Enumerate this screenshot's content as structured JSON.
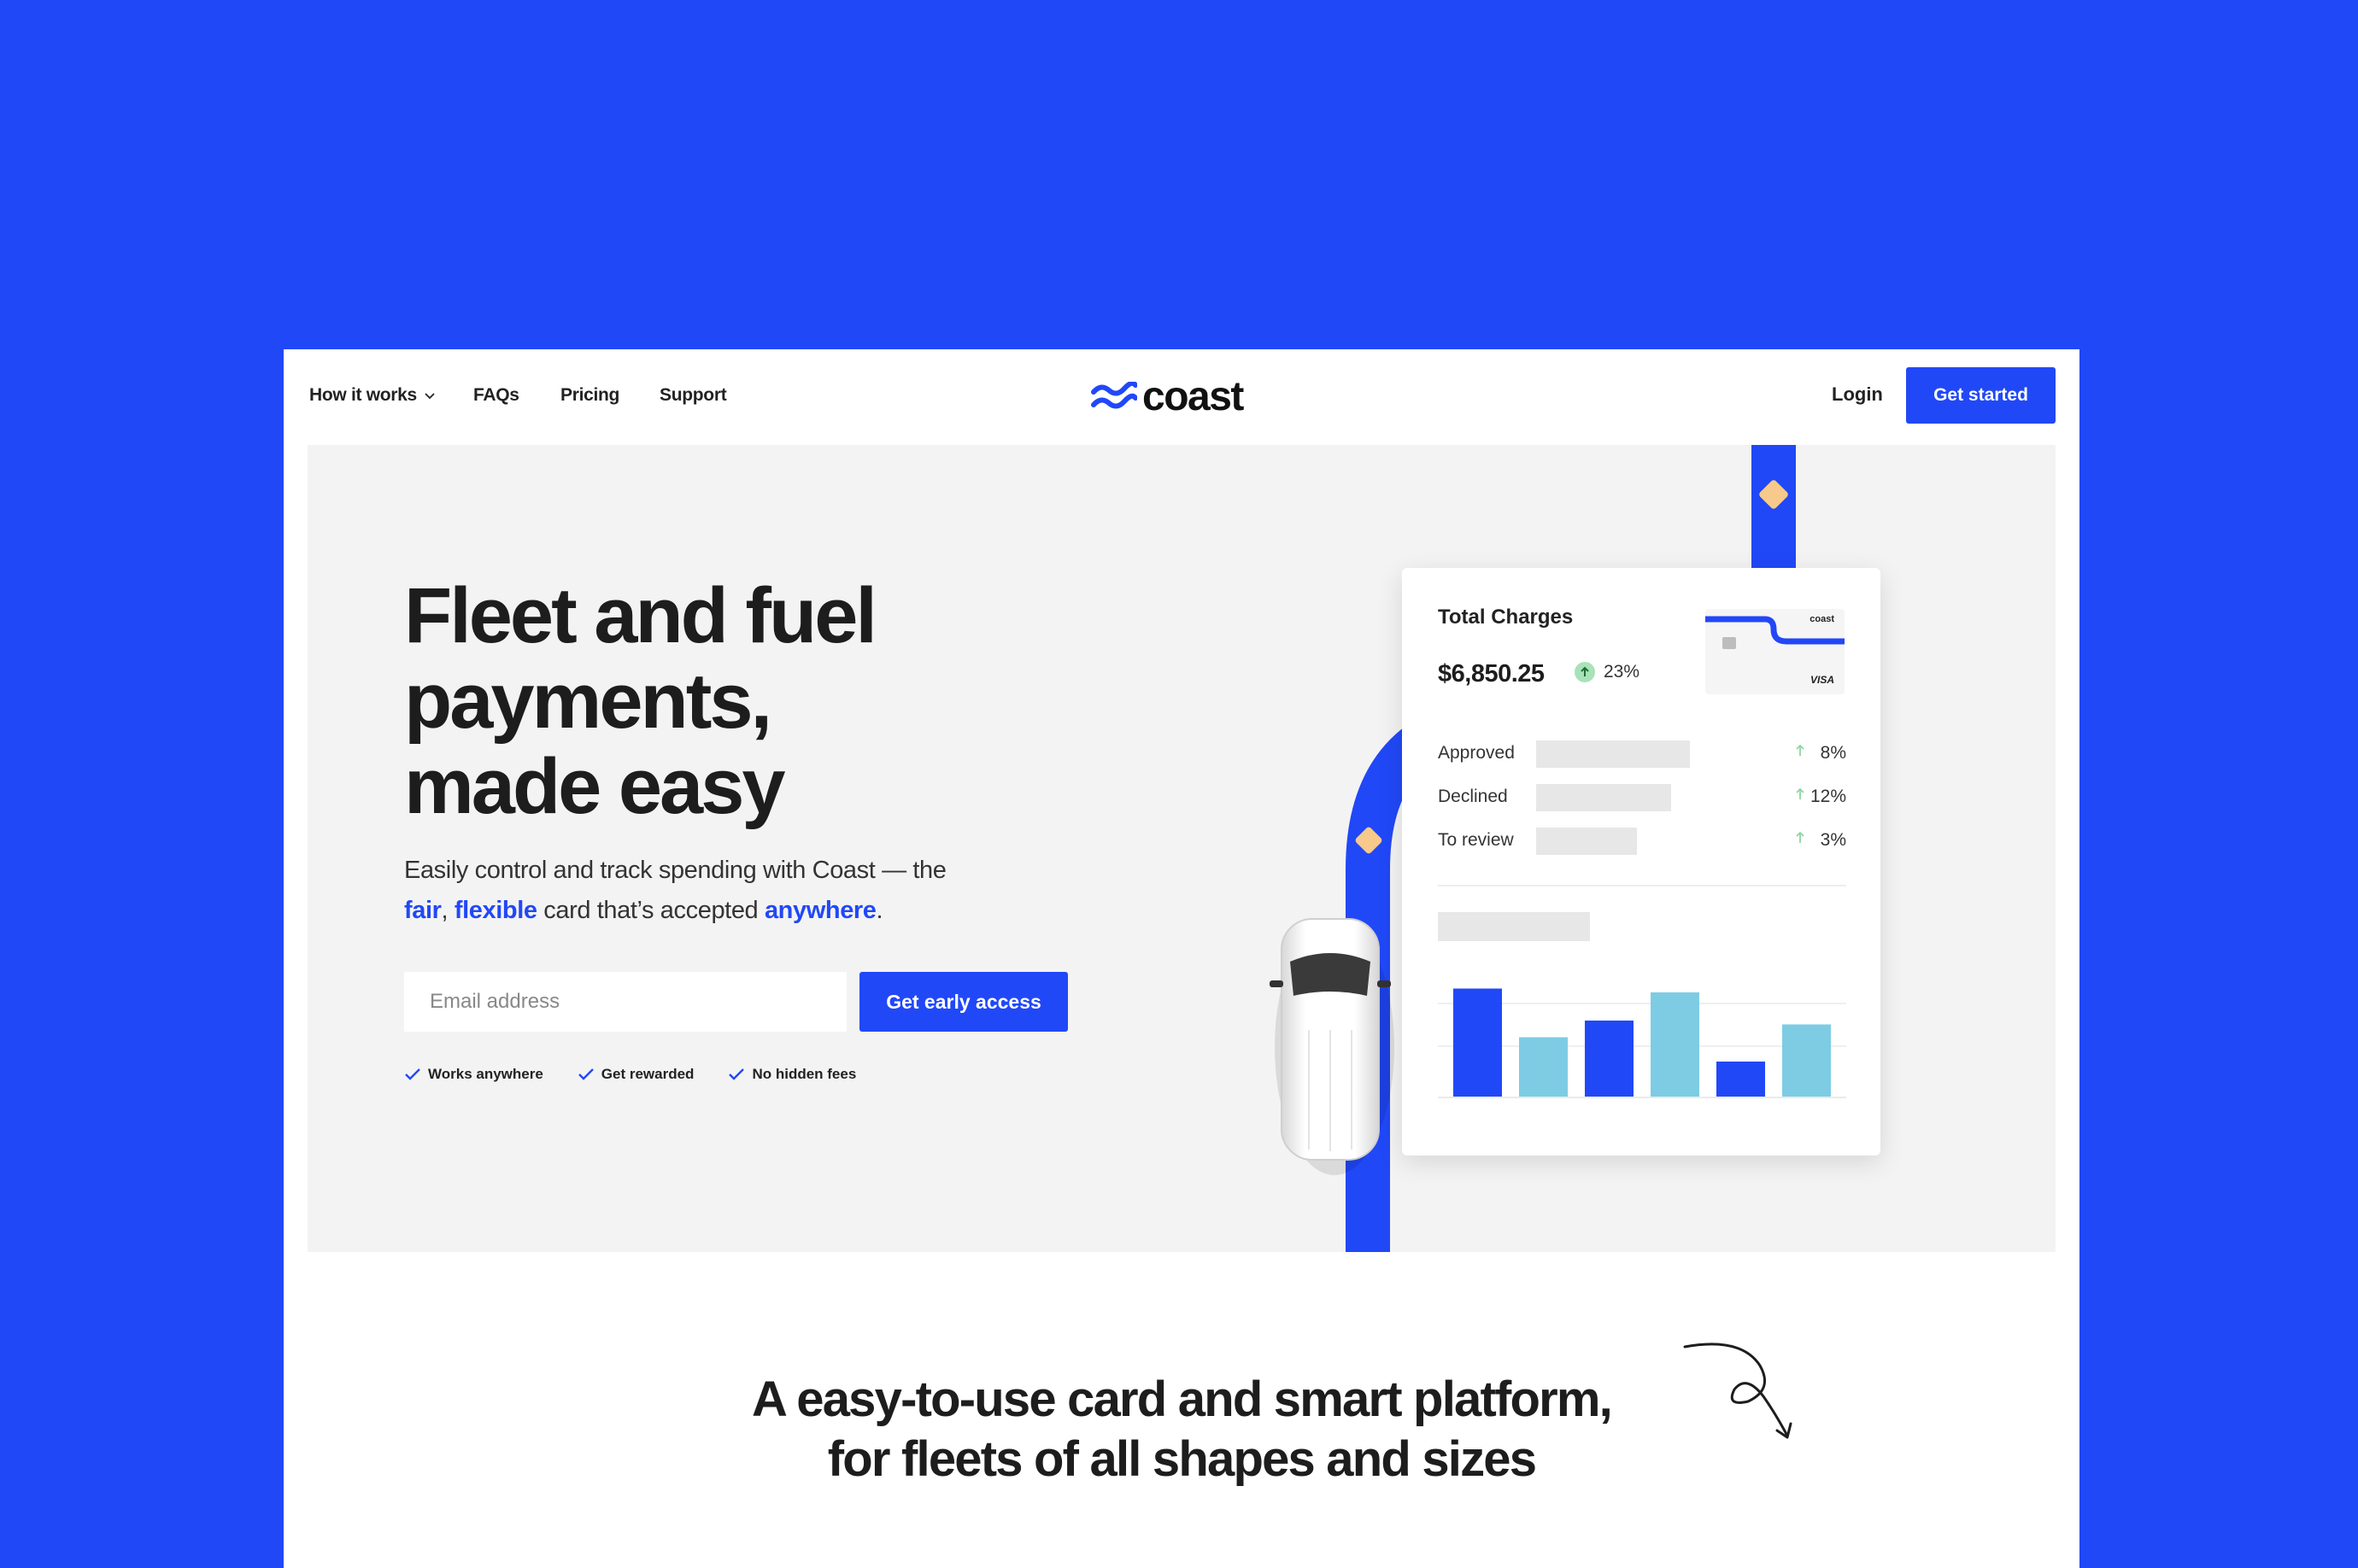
{
  "nav": {
    "how_it_works": "How it works",
    "faqs": "FAQs",
    "pricing": "Pricing",
    "support": "Support",
    "logo_text": "coast",
    "login": "Login",
    "get_started": "Get started"
  },
  "hero": {
    "headline_lines": [
      "Fleet and fuel",
      "payments,",
      "made easy"
    ],
    "subtitle_part1": "Easily control and track spending with Coast — the",
    "subtitle_fair": "fair",
    "subtitle_comma": ",",
    "subtitle_flexible": "flexible",
    "subtitle_part2": " card that’s accepted ",
    "subtitle_anywhere": "anywhere",
    "subtitle_period": ".",
    "email_placeholder": "Email address",
    "cta": "Get early access",
    "features": [
      "Works anywhere",
      "Get rewarded",
      "No hidden fees"
    ]
  },
  "dashboard": {
    "title": "Total Charges",
    "amount": "$6,850.25",
    "change": "23%",
    "mini_card_logo": "coast",
    "mini_card_network": "VISA",
    "stats": [
      {
        "label": "Approved",
        "pct": "8%",
        "fill": 0.55
      },
      {
        "label": "Declined",
        "pct": "12%",
        "fill": 0.48
      },
      {
        "label": "To review",
        "pct": "3%",
        "fill": 0.36
      }
    ],
    "bar_chart_values": [
      0.85,
      0.47,
      0.6,
      0.82,
      0.28,
      0.57
    ],
    "bar_colors": [
      "#2148F7",
      "#7DCCE4",
      "#2148F7",
      "#7DCCE4",
      "#2148F7",
      "#7DCCE4"
    ]
  },
  "tagline": {
    "line1": "A easy-to-use card and smart platform,",
    "line2": "for fleets of all shapes and sizes"
  },
  "colors": {
    "brand_blue": "#2148F7",
    "light_blue": "#7DCCE4",
    "marker_orange": "#F7C98B",
    "hero_bg": "#F3F3F3"
  }
}
